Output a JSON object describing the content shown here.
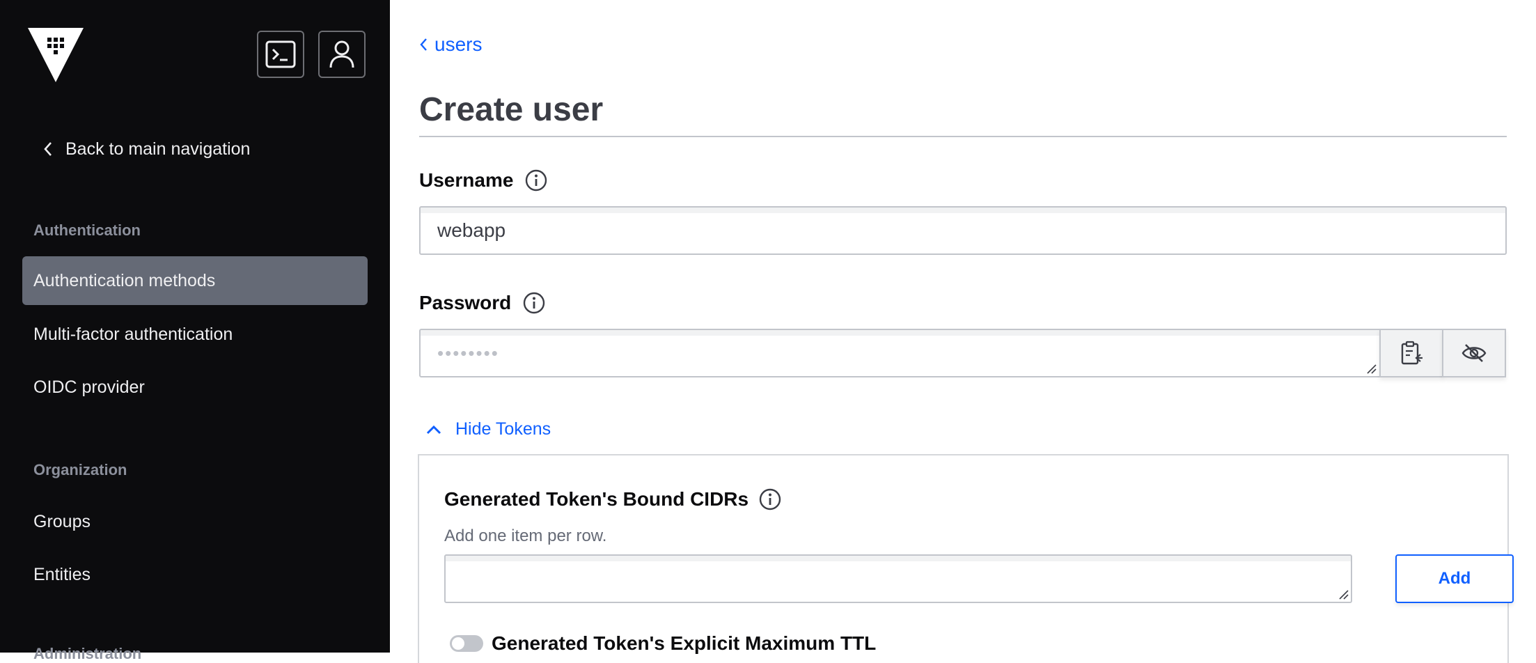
{
  "sidebar": {
    "back_label": "Back to main navigation",
    "sections": [
      {
        "heading": "Authentication",
        "items": [
          {
            "label": "Authentication methods",
            "active": true
          },
          {
            "label": "Multi-factor authentication",
            "active": false
          },
          {
            "label": "OIDC provider",
            "active": false
          }
        ]
      },
      {
        "heading": "Organization",
        "items": [
          {
            "label": "Groups",
            "active": false
          },
          {
            "label": "Entities",
            "active": false
          }
        ]
      },
      {
        "heading": "Administration",
        "items": []
      }
    ]
  },
  "breadcrumb": {
    "label": "users"
  },
  "page": {
    "title": "Create user"
  },
  "form": {
    "username": {
      "label": "Username",
      "value": "webapp"
    },
    "password": {
      "label": "Password",
      "placeholder": "••••••••"
    },
    "tokens_toggle": {
      "label": "Hide Tokens",
      "expanded": true
    },
    "bound_cidrs": {
      "label": "Generated Token's Bound CIDRs",
      "helper": "Add one item per row.",
      "value": "",
      "add_label": "Add"
    },
    "explicit_max_ttl": {
      "label": "Generated Token's Explicit Maximum TTL",
      "enabled": false
    }
  },
  "icons": {
    "logo": "vault-logo-icon",
    "terminal": "terminal-icon",
    "user": "user-icon",
    "back": "chevron-left-icon",
    "crumb": "chevron-left-icon",
    "info": "info-icon",
    "paste": "clipboard-paste-icon",
    "visibility": "eye-off-icon",
    "toggle": "chevron-up-icon"
  },
  "colors": {
    "sidebar_bg": "#0c0c0e",
    "active_item_bg": "#656a76",
    "link_blue": "#1060ff",
    "muted_text": "#8c909c"
  }
}
